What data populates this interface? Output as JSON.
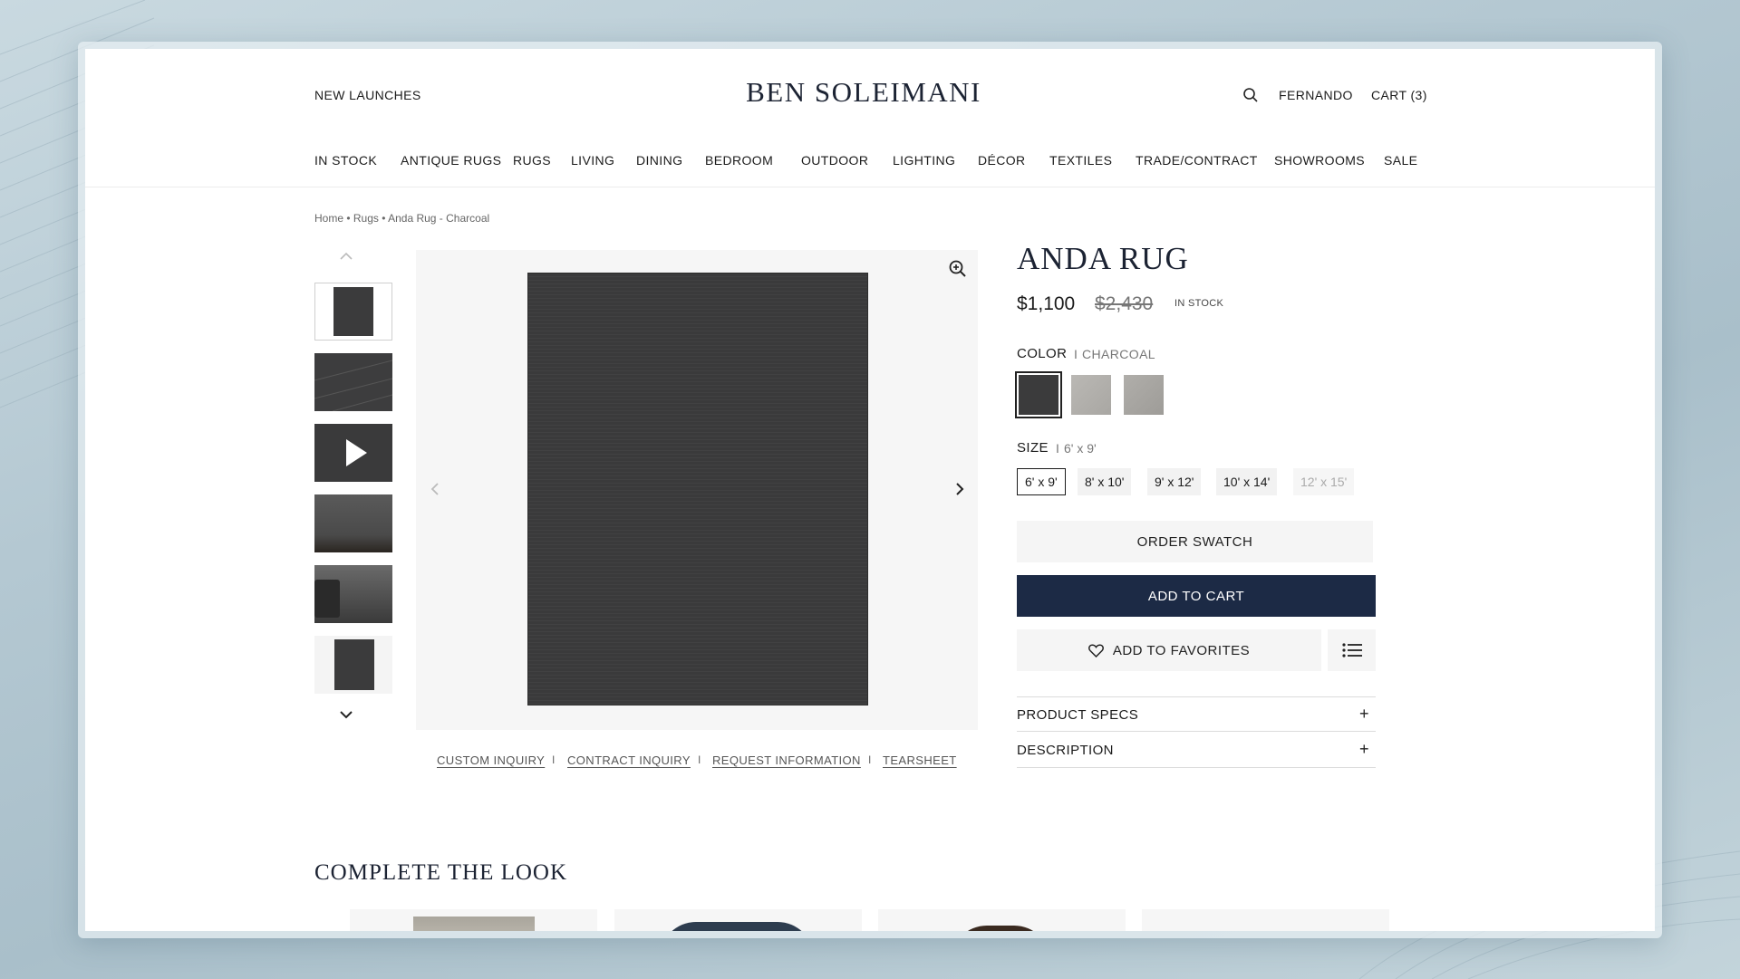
{
  "header": {
    "left_link": "NEW LAUNCHES",
    "brand": "BEN SOLEIMANI",
    "user": "FERNANDO",
    "cart": "CART (3)"
  },
  "nav": [
    "IN STOCK",
    "ANTIQUE RUGS",
    "RUGS",
    "LIVING",
    "DINING",
    "BEDROOM",
    "OUTDOOR",
    "LIGHTING",
    "DÉCOR",
    "TEXTILES",
    "TRADE/CONTRACT",
    "SHOWROOMS",
    "SALE"
  ],
  "breadcrumb": "Home • Rugs • Anda Rug - Charcoal",
  "product": {
    "title": "ANDA RUG",
    "price": "$1,100",
    "original_price": "$2,430",
    "stock": "IN STOCK",
    "color_label": "COLOR",
    "color_sep": "I",
    "color_value": "CHARCOAL",
    "size_label": "SIZE",
    "size_sep": "I",
    "size_value": "6' x 9'",
    "sizes": [
      "6' x 9'",
      "8' x 10'",
      "9' x 12'",
      "10' x 14'",
      "12' x 15'"
    ],
    "order_swatch": "ORDER SWATCH",
    "add_to_cart": "ADD TO CART",
    "add_to_favorites": "ADD TO FAVORITES",
    "accordion": [
      "PRODUCT SPECS",
      "DESCRIPTION"
    ]
  },
  "colors": {
    "swatches": [
      "#3b3b3c",
      "#b3b1ad",
      "#a9a7a3"
    ],
    "accent_navy": "#1c2a45"
  },
  "inquiry_links": [
    "CUSTOM INQUIRY",
    "CONTRACT INQUIRY",
    "REQUEST INFORMATION",
    "TEARSHEET"
  ],
  "inquiry_sep": "I",
  "complete_the_look": "COMPLETE THE LOOK"
}
